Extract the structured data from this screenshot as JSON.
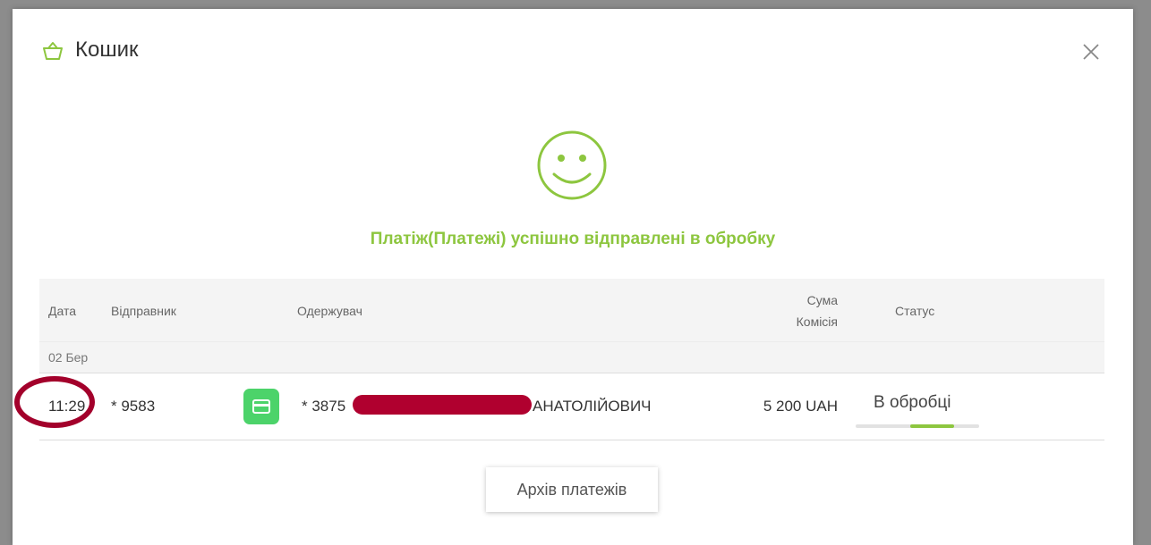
{
  "modal": {
    "title": "Кошик",
    "icons": {
      "header": "basket-icon",
      "close": "close-icon",
      "status_illustration": "smiley-icon"
    },
    "success_message": "Платіж(Платежі) успішно відправлені в обробку"
  },
  "table": {
    "headers": {
      "date": "Дата",
      "sender": "Відправник",
      "recipient": "Одержувач",
      "amount": "Сума",
      "fee": "Комісія",
      "status": "Статус"
    },
    "groups": [
      {
        "date": "02 Бер",
        "rows": [
          {
            "time": "11:29",
            "sender": "* 9583",
            "type_icon": "card-icon",
            "recipient_start": "* 3875",
            "recipient_end": "АНАТОЛІЙОВИЧ",
            "amount": "5 200 UAH",
            "status": "В обробці",
            "status_progress": {
              "start_fraction": 0.44,
              "end_fraction": 0.8
            }
          }
        ]
      }
    ]
  },
  "archive_button": "Архів платежів",
  "colors": {
    "accent": "#8dc63f",
    "card_icon": "#4cd36a",
    "annotation": "#a3002b",
    "redaction": "#b0002f"
  }
}
